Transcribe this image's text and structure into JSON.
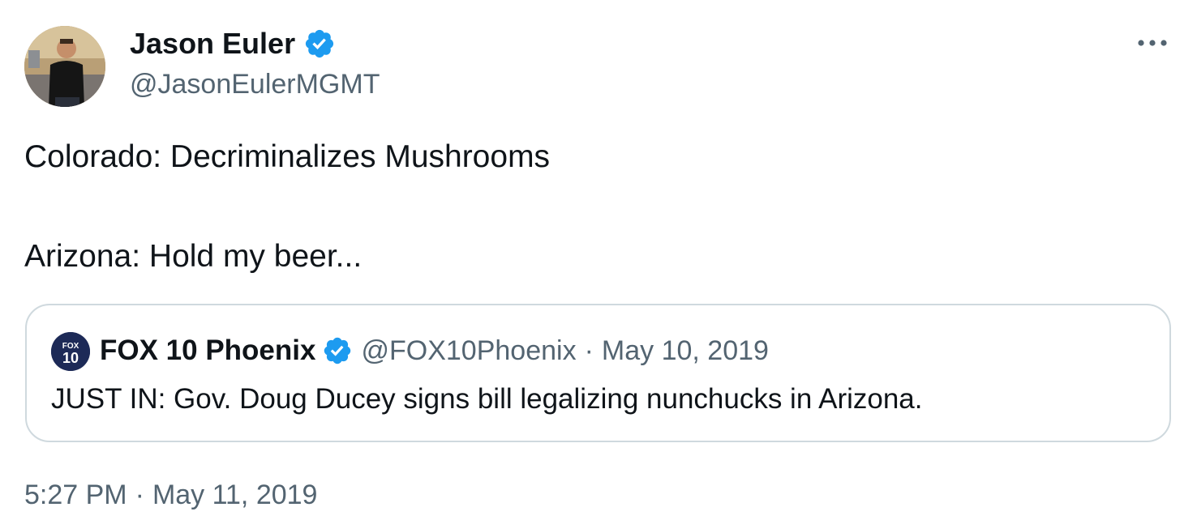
{
  "author": {
    "name": "Jason Euler",
    "handle": "@JasonEulerMGMT",
    "verified": true
  },
  "tweet": {
    "lines": [
      "Colorado: Decriminalizes Mushrooms",
      "Arizona: Hold my beer..."
    ],
    "time": "5:27 PM",
    "date": "May 11, 2019"
  },
  "quoted_tweet": {
    "author_name": "FOX 10 Phoenix",
    "author_handle": "@FOX10Phoenix",
    "separator": "·",
    "date": "May 10, 2019",
    "text": "JUST IN: Gov. Doug Ducey signs bill legalizing nunchucks in Arizona.",
    "logo_text": {
      "top": "FOX",
      "bottom": "10"
    }
  },
  "timestamp_separator": "·",
  "icons": {
    "more": "more-horizontal-icon",
    "verified": "verified-badge-icon"
  },
  "colors": {
    "verified_blue": "#1d9bf0",
    "secondary_text": "#536471",
    "border": "#cfd9de",
    "fox_logo_bg": "#1d2a57"
  }
}
